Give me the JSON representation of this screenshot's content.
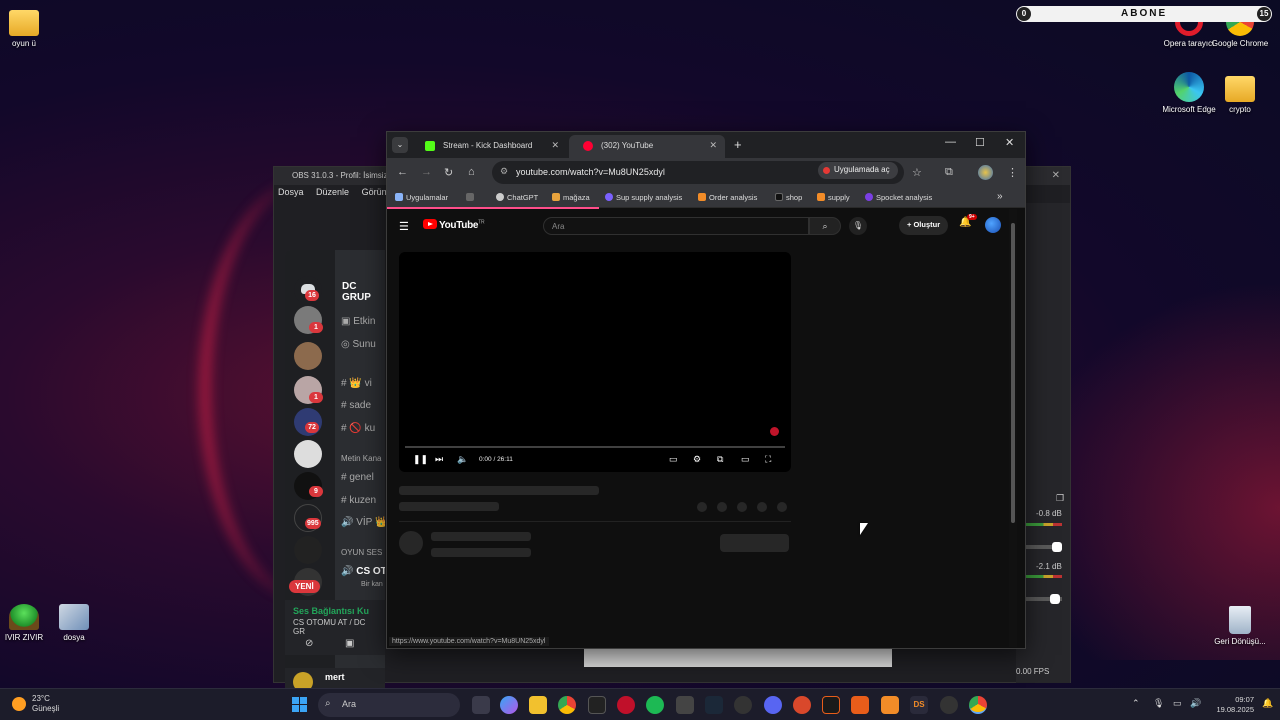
{
  "desktop": {
    "icons": [
      {
        "label": "oyun ü"
      },
      {
        "label": "Opera tarayıcı"
      },
      {
        "label": "Google Chrome"
      },
      {
        "label": "Microsoft Edge"
      },
      {
        "label": "crypto"
      },
      {
        "label": "IVIR ZIVIR"
      },
      {
        "label": "dosya"
      },
      {
        "label": "Geri Dönüşü..."
      }
    ]
  },
  "overlay": {
    "left_count": "0",
    "text": "ABONE",
    "right_count": "15"
  },
  "obs": {
    "title": "OBS 31.0.3 - Profil: İsimsiz",
    "menu": [
      "Dosya",
      "Düzenle",
      "Görünü"
    ],
    "meters": [
      "-0.8 dB",
      "-2.1 dB"
    ],
    "fps": "0.00 FPS"
  },
  "discord": {
    "server_name": "DC GRUP",
    "badges": [
      "16",
      "1",
      "1",
      "72",
      "9",
      "995"
    ],
    "channels": [
      "Etkin",
      "Sunu",
      "👑 vi",
      "sade",
      "🚫 ku",
      "Metin Kana",
      "genel",
      "kuzen",
      "VİP 👑",
      "OYUN SES",
      "CS OT"
    ],
    "voice_channel_sub": "Bir kan",
    "new_label": "YENİ",
    "voice_status": "Ses Bağlantısı Ku",
    "voice_detail": "CS OTOMU AT / DC GR",
    "username": "mert"
  },
  "chrome": {
    "tabs": [
      {
        "title": "Stream - Kick Dashboard",
        "color": "#53fc18"
      },
      {
        "title": "(302) YouTube",
        "color": "#ff0033"
      }
    ],
    "url": "youtube.com/watch?v=Mu8UN25xdyl",
    "open_in_app": "Uygulamada aç",
    "bookmarks": [
      {
        "label": "Uygulamalar",
        "color": "#8ab4f8"
      },
      {
        "label": "ChatGPT",
        "color": "#cccccc"
      },
      {
        "label": "mağaza",
        "color": "#e8a33d"
      },
      {
        "label": "Sup supply analysis",
        "color": "#7b61ff"
      },
      {
        "label": "Order analysis",
        "color": "#f28c28"
      },
      {
        "label": "shop",
        "color": "#111111"
      },
      {
        "label": "supply",
        "color": "#f28c28"
      },
      {
        "label": "Spocket analysis",
        "color": "#7b3fe4"
      }
    ],
    "status_url": "https://www.youtube.com/watch?v=Mu8UN25xdyl"
  },
  "youtube": {
    "logo": "YouTube",
    "region": "TR",
    "search_placeholder": "Ara",
    "create_label": "Oluştur",
    "notifications": "9+",
    "time": "0:00 / 26:11"
  },
  "taskbar": {
    "temperature": "23°C",
    "weather": "Güneşli",
    "search_placeholder": "Ara",
    "time": "09:07",
    "date": "19.08.2025"
  }
}
